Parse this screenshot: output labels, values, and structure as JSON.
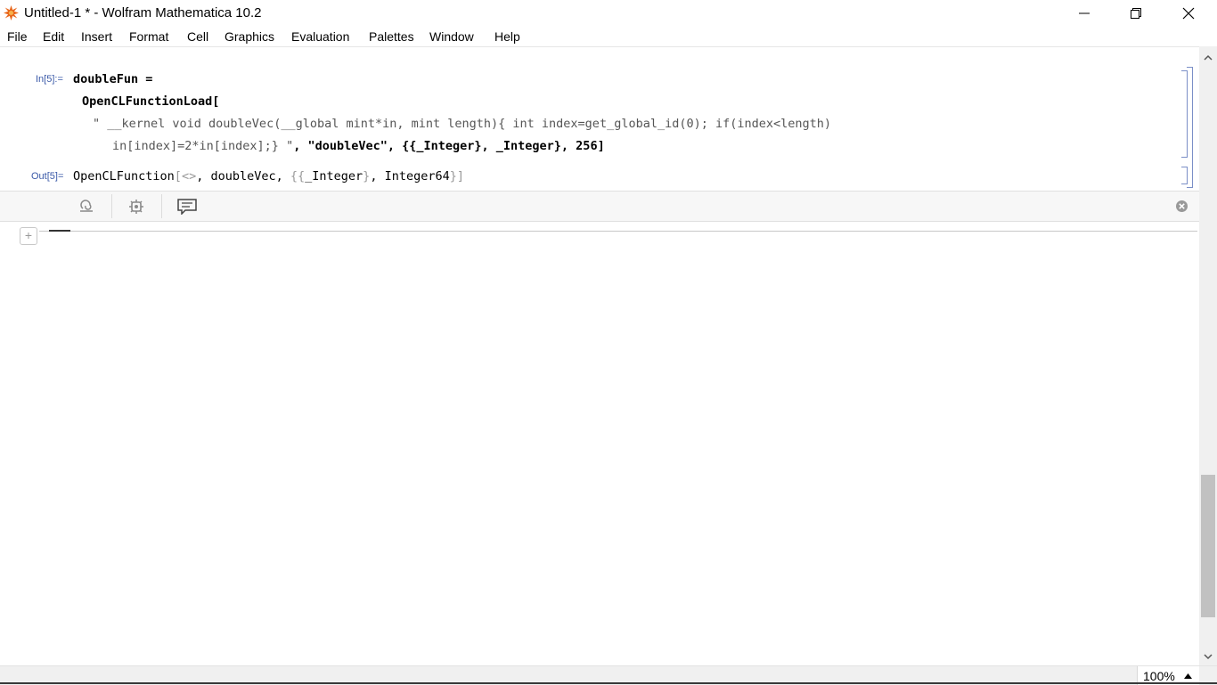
{
  "window": {
    "title": "Untitled-1 * - Wolfram Mathematica 10.2",
    "app_icon": "mathematica-spikey-icon",
    "controls": [
      "minimize-icon",
      "maximize-icon",
      "close-icon"
    ]
  },
  "menu": [
    "File",
    "Edit",
    "Insert",
    "Format",
    "Cell",
    "Graphics",
    "Evaluation",
    "Palettes",
    "Window",
    "Help"
  ],
  "notebook": {
    "input_label": "In[5]:=",
    "input_line1": "doubleFun =",
    "input_line2": "OpenCLFunctionLoad[",
    "input_line3": "\" __kernel void doubleVec(__global mint*in, mint length){ int index=get_global_id(0); if(index<length)",
    "input_line4_str": "in[index]=2*in[index];} \"",
    "input_line4_rest": ", \"doubleVec\", {{_Integer}, _Integer}, 256]",
    "output_label": "Out[5]=",
    "output_head": "OpenCLFunction",
    "output_open": "[",
    "output_arg1": "<>",
    "output_mid": ", doubleVec, ",
    "output_lbrace": "{{",
    "output_int": "_Integer",
    "output_rbrace": "}",
    "output_sep": ", ",
    "output_int64": "Integer64",
    "output_close": "}]"
  },
  "suggestions_bar": {
    "icons": [
      "kernel-swirl-icon",
      "gear-icon",
      "comment-icon"
    ],
    "close_icon": "close-circle-icon"
  },
  "status": {
    "zoom": "100%"
  },
  "colors": {
    "label_blue": "#3b5aa8",
    "bracket_blue": "#7b8fc7"
  }
}
